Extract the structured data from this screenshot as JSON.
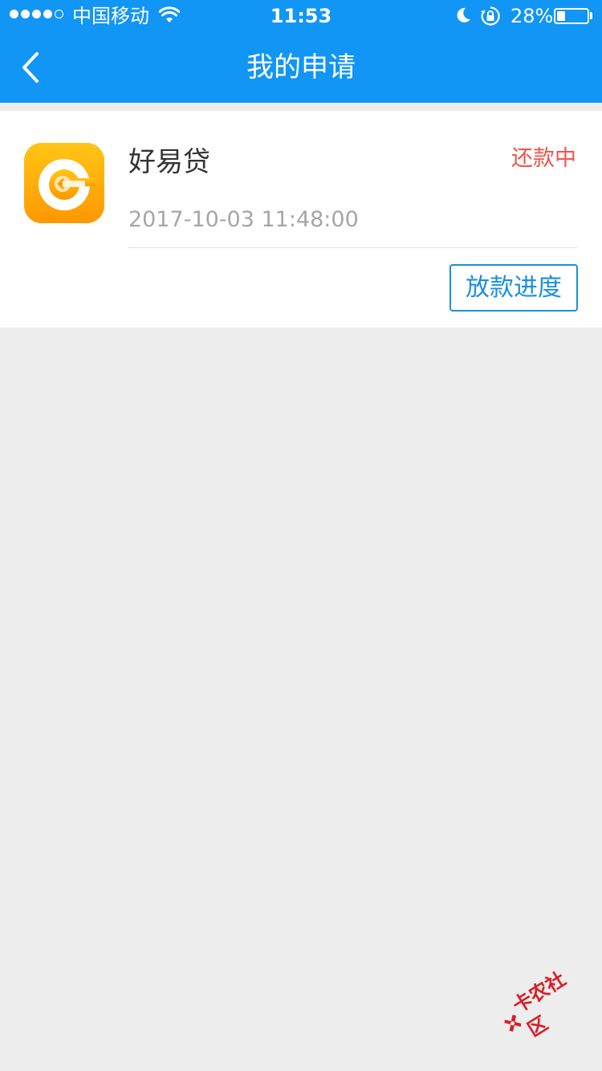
{
  "status_bar": {
    "carrier": "中国移动",
    "time": "11:53",
    "battery_percent_label": "28%",
    "battery_level": 0.28,
    "signal_bars_filled": 4,
    "signal_bars_total": 5,
    "icons": [
      "signal-dots-icon",
      "wifi-icon",
      "moon-icon",
      "rotation-lock-icon",
      "battery-icon"
    ]
  },
  "nav": {
    "title": "我的申请",
    "back_icon": "chevron-left-icon"
  },
  "colors": {
    "primary": "#1296f5",
    "status_red": "#f0554a",
    "button_blue": "#1a8fe0",
    "background": "#ededed",
    "app_icon_orange": "#ffa800"
  },
  "application": {
    "app_name": "好易贷",
    "status": "还款中",
    "time": "2017-10-03 11:48:00",
    "action_label": "放款进度",
    "icon": "hao-yi-dai-app-icon"
  },
  "watermark": {
    "text": "卡农社区",
    "icon": "kanong-logo-icon"
  }
}
